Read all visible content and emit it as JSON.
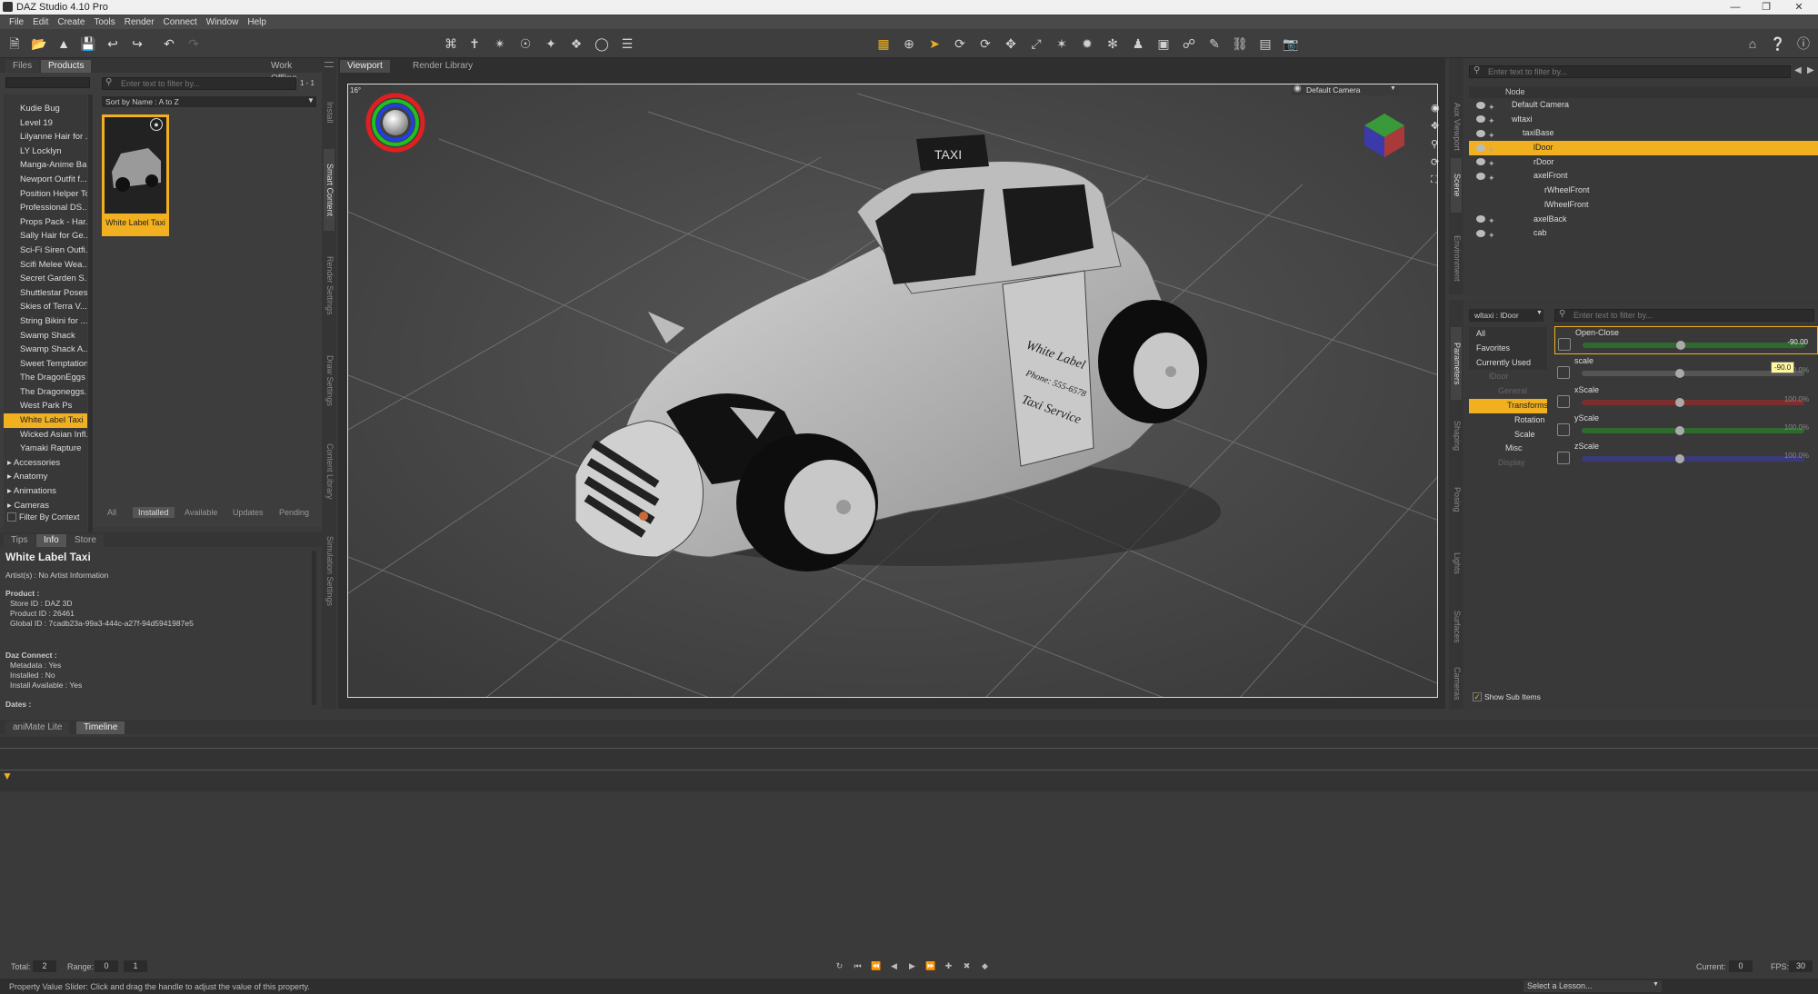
{
  "app": {
    "title": "DAZ Studio 4.10 Pro"
  },
  "menu": [
    "File",
    "Edit",
    "Create",
    "Tools",
    "Render",
    "Connect",
    "Window",
    "Help"
  ],
  "left_panel": {
    "tabs": [
      "Files",
      "Products"
    ],
    "work_offline": "Work Offline",
    "filter_placeholder": "Enter text to filter by...",
    "count": "1 - 1",
    "sort": "Sort by Name : A to Z",
    "products": [
      "Kudie Bug",
      "Level 19",
      "Lilyanne Hair for ...",
      "LY Locklyn",
      "Manga-Anime Ba...",
      "Newport Outfit f...",
      "Position Helper Tool",
      "Professional DS...",
      "Props Pack - Har...",
      "Sally Hair for Ge...",
      "Sci-Fi Siren Outfi...",
      "Scifi Melee Wea...",
      "Secret Garden S...",
      "Shuttlestar Poses",
      "Skies of Terra V...",
      "String Bikini for ...",
      "Swamp Shack",
      "Swamp Shack A...",
      "Sweet Temptation",
      "The DragonEggs",
      "The Dragoneggs...",
      "West Park Ps",
      "White Label Taxi",
      "Wicked Asian Infl...",
      "Yamaki Rapture"
    ],
    "selected_product": "White Label Taxi",
    "categories": [
      "Accessories",
      "Anatomy",
      "Animations",
      "Cameras"
    ],
    "filter_by_context": "Filter By Context",
    "thumb_label": "White Label Taxi",
    "bottom_tabs": [
      "All",
      "Installed",
      "Available",
      "Updates",
      "Pending"
    ],
    "vtabs": [
      "Install",
      "Smart Content",
      "Render Settings",
      "Draw Settings",
      "Content Library",
      "Simulation Settings"
    ]
  },
  "info_panel": {
    "tabs": [
      "Tips",
      "Info",
      "Store"
    ],
    "title": "White Label Taxi",
    "artists": "Artist(s) : No Artist Information",
    "product_header": "Product :",
    "store_id": "Store ID : DAZ 3D",
    "product_id": "Product ID : 26461",
    "global_id": "Global ID : 7cadb23a-99a3-444c-a27f-94d5941987e5",
    "daz_connect": "Daz Connect :",
    "metadata": "Metadata : Yes",
    "installed": "Installed : No",
    "install_available": "Install Available : Yes",
    "dates": "Dates :"
  },
  "viewport": {
    "tabs": [
      "Viewport",
      "Render Library"
    ],
    "camera": "Default Camera",
    "focal": "16°",
    "sign_text": "TAXI",
    "door_text": [
      "White Label",
      "Phone: 555-6578",
      "Taxi Service"
    ]
  },
  "scene": {
    "filter_placeholder": "Enter text to filter by...",
    "header": "Node",
    "vtabs": [
      "Aux Viewport",
      "Scene",
      "Environment"
    ],
    "nodes": [
      {
        "label": "Default Camera",
        "indent": 0
      },
      {
        "label": "wltaxi",
        "indent": 0
      },
      {
        "label": "taxiBase",
        "indent": 1
      },
      {
        "label": "lDoor",
        "indent": 2,
        "selected": true
      },
      {
        "label": "rDoor",
        "indent": 2
      },
      {
        "label": "axelFront",
        "indent": 2
      },
      {
        "label": "rWheelFront",
        "indent": 3
      },
      {
        "label": "lWheelFront",
        "indent": 3
      },
      {
        "label": "axelBack",
        "indent": 2
      },
      {
        "label": "cab",
        "indent": 2
      }
    ]
  },
  "parameters": {
    "node_select": "wltaxi : lDoor",
    "filter_placeholder": "Enter text to filter by...",
    "vtabs": [
      "Parameters",
      "Shaping",
      "Posing",
      "Lights",
      "Surfaces",
      "Cameras"
    ],
    "tree": [
      "All",
      "Favorites",
      "Currently Used",
      "lDoor",
      "General",
      "Transforms",
      "Rotation",
      "Scale",
      "Misc",
      "Display"
    ],
    "selected_tree": "Transforms",
    "show_sub_items": "Show Sub Items",
    "props": [
      {
        "label": "Open-Close",
        "value": "-90.00",
        "color": "#2e6a2e",
        "level": 0.5
      },
      {
        "label": "scale",
        "value": "100.0%",
        "color": "#666666",
        "level": 0.5
      },
      {
        "label": "xScale",
        "value": "100.0%",
        "color": "#7a2e2e",
        "level": 0.5
      },
      {
        "label": "yScale",
        "value": "100.0%",
        "color": "#2e6a2e",
        "level": 0.5
      },
      {
        "label": "zScale",
        "value": "100.0%",
        "color": "#3a3a7a",
        "level": 0.5
      }
    ],
    "tooltip_value": "-90.0"
  },
  "timeline": {
    "tabs": [
      "aniMate Lite",
      "Timeline"
    ],
    "total_label": "Total:",
    "total": "2",
    "range_label": "Range:",
    "range_start": "0",
    "range_end": "1",
    "current_label": "Current:",
    "current": "0",
    "fps_label": "FPS:",
    "fps": "30"
  },
  "status": {
    "message": "Property Value Slider: Click and drag the handle to adjust the value of this property.",
    "lesson": "Select a Lesson..."
  }
}
